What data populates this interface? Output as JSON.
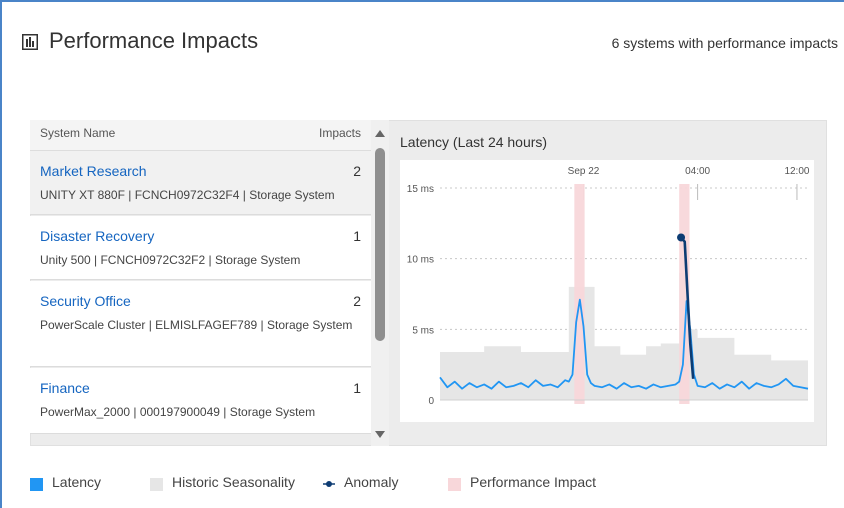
{
  "header": {
    "title": "Performance Impacts",
    "summary": "6 systems with performance impacts",
    "icon": "bar-chart-icon"
  },
  "systems_list": {
    "columns": {
      "name": "System Name",
      "impacts": "Impacts"
    },
    "items": [
      {
        "name": "Market Research",
        "impacts": "2",
        "desc": "UNITY XT 880F | FCNCH0972C32F4 | Storage System",
        "selected": true
      },
      {
        "name": "Disaster Recovery",
        "impacts": "1",
        "desc": "Unity 500 | FCNCH0972C32F2 | Storage System",
        "selected": false
      },
      {
        "name": "Security Office",
        "impacts": "2",
        "desc": "PowerScale Cluster | ELMISLFAGEF789 | Storage System",
        "selected": false
      },
      {
        "name": "Finance",
        "impacts": "1",
        "desc": "PowerMax_2000 | 000197900049 | Storage System",
        "selected": false
      }
    ]
  },
  "chart_title": "Latency (Last 24 hours)",
  "legend": [
    {
      "label": "Latency",
      "color": "#2196f3",
      "kind": "square"
    },
    {
      "label": "Historic Seasonality",
      "color": "#e6e6e6",
      "kind": "square"
    },
    {
      "label": "Anomaly",
      "color": "#0d3c73",
      "kind": "line-dot"
    },
    {
      "label": "Performance Impact",
      "color": "#f8d7da",
      "kind": "square"
    }
  ],
  "chart_data": {
    "type": "line",
    "title": "Latency (Last 24 hours)",
    "x_ticks": [
      "Sep 22",
      "04:00",
      "12:00"
    ],
    "y_ticks": [
      "0",
      "5 ms",
      "10 ms",
      "15 ms"
    ],
    "ylim": [
      0,
      15
    ],
    "x_range": [
      0,
      100
    ],
    "x_tick_positions": [
      39,
      70,
      97
    ],
    "series": [
      {
        "name": "Latency",
        "color": "#2196f3",
        "x": [
          0,
          2,
          4,
          6,
          8,
          10,
          12,
          14,
          16,
          18,
          20,
          22,
          24,
          26,
          28,
          30,
          32,
          34,
          35,
          36,
          37,
          38,
          39,
          40,
          41,
          42,
          44,
          46,
          48,
          50,
          52,
          54,
          56,
          58,
          60,
          62,
          64,
          65,
          66,
          67,
          68,
          69,
          70,
          72,
          74,
          76,
          78,
          80,
          82,
          84,
          86,
          88,
          90,
          92,
          94,
          96,
          98,
          100
        ],
        "y": [
          1.6,
          0.9,
          1.3,
          0.8,
          1.2,
          0.9,
          1.1,
          0.8,
          1.3,
          0.9,
          1.0,
          1.2,
          0.9,
          1.4,
          1.0,
          1.1,
          0.9,
          1.4,
          1.3,
          1.8,
          5.5,
          7.1,
          5.2,
          1.8,
          1.2,
          1.0,
          0.9,
          1.1,
          0.8,
          1.2,
          0.9,
          1.0,
          0.8,
          1.1,
          0.9,
          1.0,
          1.1,
          1.3,
          2.5,
          7.0,
          5.0,
          1.8,
          1.0,
          0.9,
          1.2,
          0.8,
          1.1,
          0.9,
          1.3,
          0.8,
          1.2,
          1.0,
          0.9,
          1.1,
          1.5,
          1.0,
          0.9,
          0.8
        ]
      },
      {
        "name": "Anomaly",
        "color": "#0d3c73",
        "x": [
          65.5,
          66.5,
          67.2,
          68.0,
          68.8
        ],
        "y": [
          11.5,
          11.2,
          7.8,
          4.0,
          1.5
        ]
      }
    ],
    "historic_seasonality": {
      "x": [
        0,
        12,
        12,
        22,
        22,
        35,
        35,
        42,
        42,
        49,
        49,
        56,
        56,
        60,
        60,
        65,
        65,
        67,
        67,
        70,
        70,
        80,
        80,
        90,
        90,
        100
      ],
      "upper": [
        3.4,
        3.4,
        3.8,
        3.8,
        3.4,
        3.4,
        8.0,
        8.0,
        3.8,
        3.8,
        3.2,
        3.2,
        3.8,
        3.8,
        4.0,
        4.0,
        9.0,
        9.0,
        5.0,
        5.0,
        4.4,
        4.4,
        3.2,
        3.2,
        2.8,
        2.8
      ]
    },
    "performance_impact_windows": [
      [
        36.5,
        39.3
      ],
      [
        65.0,
        67.8
      ]
    ]
  }
}
